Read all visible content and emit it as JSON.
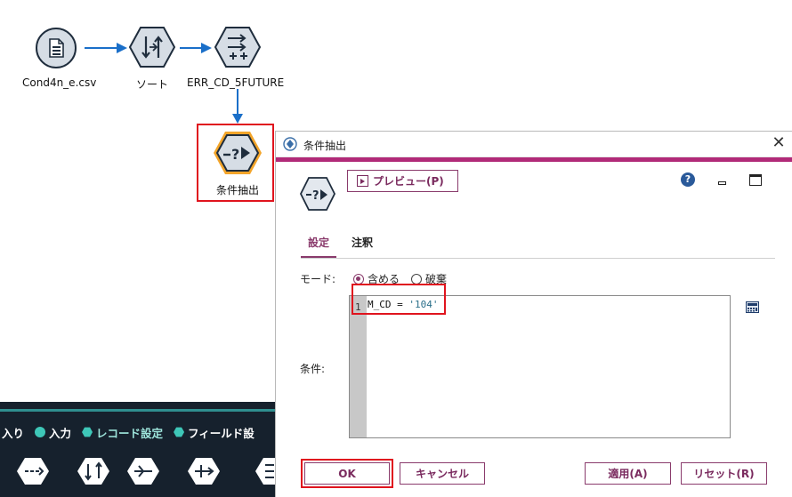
{
  "stream": {
    "nodes": [
      {
        "label": "Cond4n_e.csv"
      },
      {
        "label": "ソート"
      },
      {
        "label": "ERR_CD_5FUTURE"
      },
      {
        "label": "条件抽出"
      }
    ]
  },
  "palette": {
    "tabs": [
      {
        "label": "入り"
      },
      {
        "label": "入力"
      },
      {
        "label": "レコード設定"
      },
      {
        "label": "フィールド設"
      }
    ]
  },
  "dialog": {
    "title": "条件抽出",
    "preview_label": "プレビュー(P)",
    "tabs": [
      {
        "label": "設定"
      },
      {
        "label": "注釈"
      }
    ],
    "mode_label": "モード:",
    "mode_options": [
      {
        "label": "含める",
        "selected": true
      },
      {
        "label": "破棄",
        "selected": false
      }
    ],
    "condition_label": "条件:",
    "editor": {
      "line_number": "1",
      "code_prefix": "M_CD = ",
      "code_string": "'104'"
    },
    "buttons": {
      "ok": "OK",
      "cancel": "キャンセル",
      "apply": "適用(A)",
      "reset": "リセット(R)"
    }
  },
  "colors": {
    "accent": "#8a3b6c",
    "pink_bar": "#b12a78",
    "highlight": "#e0141e",
    "connector": "#1a6fc9",
    "palette_bg": "#16212d"
  }
}
